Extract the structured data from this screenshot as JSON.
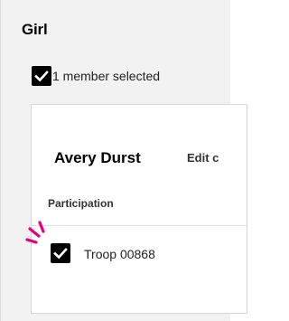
{
  "section": {
    "title": "Girl",
    "selection_text": "1 member selected"
  },
  "member_card": {
    "name": "Avery Durst",
    "edit_link": "Edit c",
    "participation_label": "Participation",
    "troop_label": "Troop 00868",
    "troop_checked": true
  },
  "colors": {
    "panel_bg": "#f2f2f2",
    "checkbox_fill": "#000000",
    "highlight_marks": "#e6007e"
  },
  "icons": [
    "check-icon",
    "sparkle-icon"
  ]
}
